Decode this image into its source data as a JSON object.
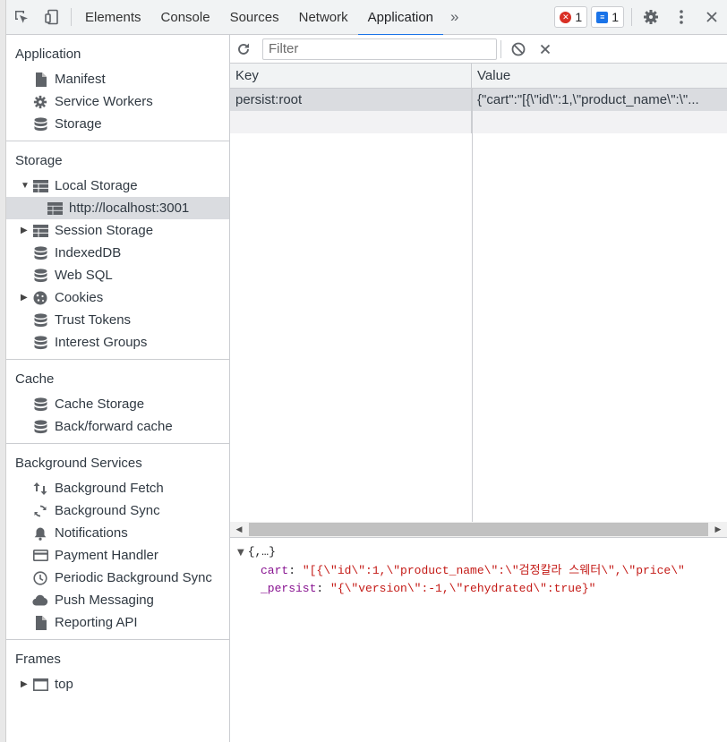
{
  "toolbar": {
    "tabs": [
      "Elements",
      "Console",
      "Sources",
      "Network",
      "Application"
    ],
    "more": "»",
    "error_count": "1",
    "message_count": "1"
  },
  "sidebar": {
    "application": {
      "title": "Application",
      "items": [
        "Manifest",
        "Service Workers",
        "Storage"
      ]
    },
    "storage": {
      "title": "Storage",
      "local_storage": "Local Storage",
      "local_origin": "http://localhost:3001",
      "items": [
        "Session Storage",
        "IndexedDB",
        "Web SQL",
        "Cookies",
        "Trust Tokens",
        "Interest Groups"
      ]
    },
    "cache": {
      "title": "Cache",
      "items": [
        "Cache Storage",
        "Back/forward cache"
      ]
    },
    "background": {
      "title": "Background Services",
      "items": [
        "Background Fetch",
        "Background Sync",
        "Notifications",
        "Payment Handler",
        "Periodic Background Sync",
        "Push Messaging",
        "Reporting API"
      ]
    },
    "frames": {
      "title": "Frames",
      "items": [
        "top"
      ]
    }
  },
  "main": {
    "filter_placeholder": "Filter",
    "columns": {
      "key": "Key",
      "value": "Value"
    },
    "rows": [
      {
        "key": "persist:root",
        "value": "{\"cart\":\"[{\\\"id\\\":1,\\\"product_name\\\":\\\"..."
      }
    ],
    "preview": {
      "head": "{,…}",
      "lines": [
        {
          "key": "cart",
          "value": "\"[{\\\"id\\\":1,\\\"product_name\\\":\\\"검정칼라 스웨터\\\",\\\"price\\\""
        },
        {
          "key": "_persist",
          "value": "\"{\\\"version\\\":-1,\\\"rehydrated\\\":true}\""
        }
      ]
    }
  }
}
